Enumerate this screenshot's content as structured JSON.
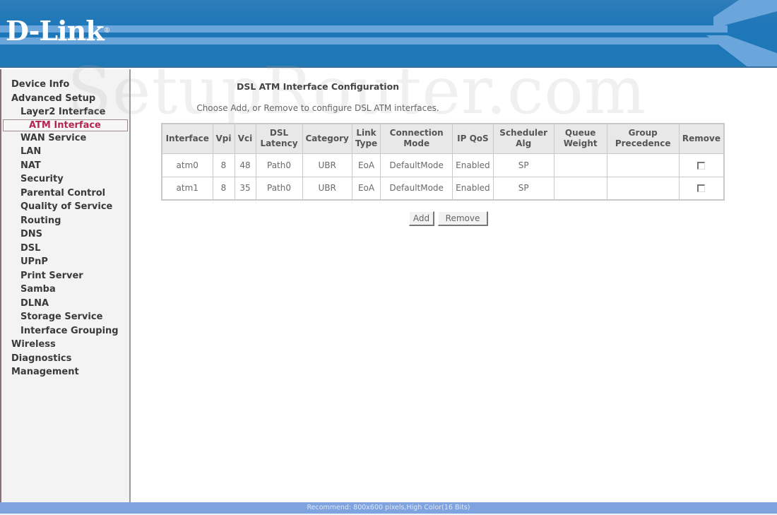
{
  "brand": {
    "logo_text": "D-Link",
    "logo_mark": "®"
  },
  "watermark": "SetupRouter.com",
  "sidebar": {
    "items": [
      {
        "label": "Device Info",
        "level": 0
      },
      {
        "label": "Advanced Setup",
        "level": 0
      },
      {
        "label": "Layer2 Interface",
        "level": 1
      },
      {
        "label": "ATM Interface",
        "level": 2,
        "active": true
      },
      {
        "label": "WAN Service",
        "level": 1
      },
      {
        "label": "LAN",
        "level": 1
      },
      {
        "label": "NAT",
        "level": 1
      },
      {
        "label": "Security",
        "level": 1
      },
      {
        "label": "Parental Control",
        "level": 1
      },
      {
        "label": "Quality of Service",
        "level": 1
      },
      {
        "label": "Routing",
        "level": 1
      },
      {
        "label": "DNS",
        "level": 1
      },
      {
        "label": "DSL",
        "level": 1
      },
      {
        "label": "UPnP",
        "level": 1
      },
      {
        "label": "Print Server",
        "level": 1
      },
      {
        "label": "Samba",
        "level": 1
      },
      {
        "label": "DLNA",
        "level": 1
      },
      {
        "label": "Storage Service",
        "level": 1
      },
      {
        "label": "Interface Grouping",
        "level": 1
      },
      {
        "label": "Wireless",
        "level": 0
      },
      {
        "label": "Diagnostics",
        "level": 0
      },
      {
        "label": "Management",
        "level": 0
      }
    ],
    "active_color": "#b5264f"
  },
  "main": {
    "title": "DSL ATM Interface Configuration",
    "subtitle": "Choose Add, or Remove to configure DSL ATM interfaces.",
    "table": {
      "headers": [
        [
          "Interface"
        ],
        [
          "Vpi"
        ],
        [
          "Vci"
        ],
        [
          "DSL",
          "Latency"
        ],
        [
          "Category"
        ],
        [
          "Link",
          "Type"
        ],
        [
          "Connection",
          "Mode"
        ],
        [
          "IP QoS"
        ],
        [
          "Scheduler",
          "Alg"
        ],
        [
          "Queue",
          "Weight"
        ],
        [
          "Group",
          "Precedence"
        ],
        [
          "Remove"
        ]
      ],
      "rows": [
        {
          "interface": "atm0",
          "vpi": "8",
          "vci": "48",
          "latency": "Path0",
          "category": "UBR",
          "link_type": "EoA",
          "mode": "DefaultMode",
          "ip_qos": "Enabled",
          "scheduler": "SP",
          "queue_weight": "",
          "group_precedence": "",
          "remove_checked": false
        },
        {
          "interface": "atm1",
          "vpi": "8",
          "vci": "35",
          "latency": "Path0",
          "category": "UBR",
          "link_type": "EoA",
          "mode": "DefaultMode",
          "ip_qos": "Enabled",
          "scheduler": "SP",
          "queue_weight": "",
          "group_precedence": "",
          "remove_checked": false
        }
      ]
    },
    "buttons": {
      "add": "Add",
      "remove": "Remove"
    }
  },
  "footer": {
    "text": "Recommend: 800x600 pixels,High Color(16 Bits)"
  }
}
